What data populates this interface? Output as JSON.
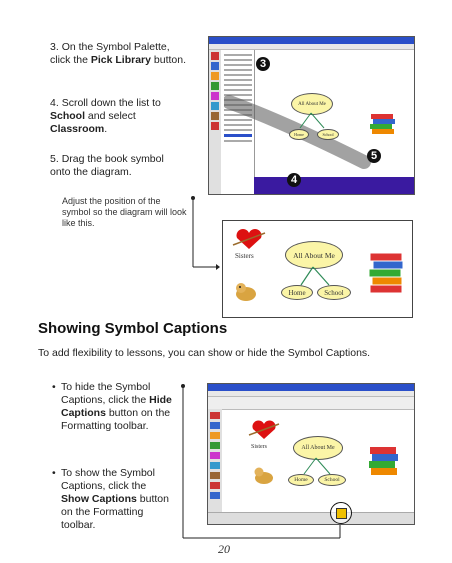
{
  "section1": {
    "steps": [
      {
        "num": "3.",
        "pre": "On the Symbol Palette, click the ",
        "bold": "Pick Library",
        "post": " button."
      },
      {
        "num": "4.",
        "pre": "Scroll down the list to ",
        "bold": "School",
        "mid": " and select ",
        "bold2": "Classroom",
        "post": "."
      },
      {
        "num": "5.",
        "pre": "Drag the book symbol onto the diagram."
      }
    ],
    "note": "Adjust the position of the symbol so the diagram will look like this.",
    "callouts": [
      "3",
      "4",
      "5"
    ]
  },
  "diagram": {
    "center": "All About Me",
    "left": "Home",
    "right": "School",
    "side_label": "Sisters"
  },
  "section2": {
    "title": "Showing Symbol Captions",
    "intro": "To add flexibility to lessons, you can show or hide the Symbol Captions.",
    "bullets": [
      {
        "pre": "To hide the Symbol Captions, click the ",
        "bold": "Hide Captions",
        "post": " button on the Formatting toolbar."
      },
      {
        "pre": "To show the Symbol Captions, click the ",
        "bold": "Show Captions",
        "post": " button on the Formatting toolbar."
      }
    ]
  },
  "page_number": "20",
  "colors": {
    "title_bar": "#2a4fc9",
    "oval_fill": "#fbf5a7",
    "arrow": "#2e8b57",
    "purple_panel": "#3a1aa0"
  }
}
